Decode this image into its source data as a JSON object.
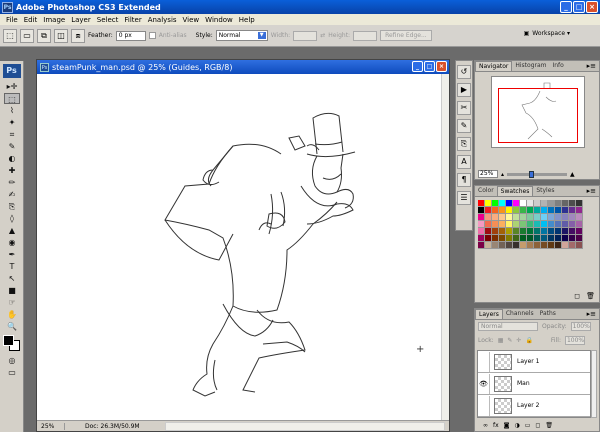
{
  "app": {
    "title": "Adobe Photoshop CS3 Extended",
    "icon_text": "Ps"
  },
  "window_controls": {
    "minimize": "_",
    "maximize": "□",
    "close": "×"
  },
  "menu": [
    "File",
    "Edit",
    "Image",
    "Layer",
    "Select",
    "Filter",
    "Analysis",
    "View",
    "Window",
    "Help"
  ],
  "options_bar": {
    "feather_label": "Feather:",
    "feather_value": "0 px",
    "antialias_label": "Anti-alias",
    "style_label": "Style:",
    "style_value": "Normal",
    "width_label": "Width:",
    "height_label": "Height:",
    "refine_edge": "Refine Edge...",
    "workspace": "Workspace ▾"
  },
  "tools": {
    "logo": "Ps",
    "icons": [
      "▸✛",
      "⬚",
      "⌇",
      "✦",
      "⌗",
      "✎",
      "◐",
      "✚",
      "✏",
      "✍",
      "⎘",
      "◊",
      "▲",
      "◉",
      "✒",
      "T",
      "↖",
      "■",
      "☞",
      "✋",
      "🔍"
    ]
  },
  "document": {
    "title": "steamPunk_man.psd @ 25% (Guides, RGB/8)",
    "icon_text": "Ps",
    "zoom": "25%",
    "doc_size": "Doc: 26.3M/50.9M"
  },
  "navigator": {
    "tabs": [
      "Navigator",
      "Histogram",
      "Info"
    ],
    "zoom": "25%"
  },
  "swatches_panel": {
    "tabs": [
      "Color",
      "Swatches",
      "Styles"
    ],
    "colors": [
      "#ff0000",
      "#ffff00",
      "#00ff00",
      "#00ffff",
      "#0000ff",
      "#ff00ff",
      "#ffffff",
      "#e6e6e6",
      "#cccccc",
      "#b3b3b3",
      "#999999",
      "#808080",
      "#666666",
      "#4d4d4d",
      "#333333",
      "#000000",
      "#ed1c24",
      "#f26522",
      "#f7941d",
      "#fff200",
      "#8dc63f",
      "#39b54a",
      "#00a651",
      "#00a99d",
      "#00aeef",
      "#0072bc",
      "#0054a6",
      "#2e3192",
      "#662d91",
      "#92278f",
      "#ec008c",
      "#f7977a",
      "#f9ad81",
      "#fdc68a",
      "#fff79a",
      "#c4df9b",
      "#a3d39c",
      "#82ca9d",
      "#7bcdc8",
      "#6ecff6",
      "#7ea7d8",
      "#8493ca",
      "#8882be",
      "#a187be",
      "#bc8dbf",
      "#f49ac2",
      "#f26c4f",
      "#f68e56",
      "#fbaf5d",
      "#fff568",
      "#acd373",
      "#7cc576",
      "#3bb878",
      "#1abbb4",
      "#00bff3",
      "#438ccb",
      "#5574b9",
      "#605ca8",
      "#855fa8",
      "#a763a8",
      "#f06eaa",
      "#9e0b0f",
      "#a0410d",
      "#a36209",
      "#aba000",
      "#598527",
      "#1a7b30",
      "#007236",
      "#00746b",
      "#0076a3",
      "#004b80",
      "#003471",
      "#1b1464",
      "#440e62",
      "#630460",
      "#9e005d",
      "#790000",
      "#7b2e00",
      "#7d4900",
      "#827b00",
      "#406618",
      "#005e20",
      "#005826",
      "#005952",
      "#005b7f",
      "#003663",
      "#002157",
      "#0d004c",
      "#32004b",
      "#4b0049",
      "#7b0046",
      "#c7b299",
      "#998675",
      "#736357",
      "#534741",
      "#37302d",
      "#c69c6d",
      "#a67c52",
      "#8c6239",
      "#754c24",
      "#603913",
      "#3c2415",
      "#d1a59a",
      "#a36b6b",
      "#8a5252"
    ]
  },
  "layers_panel": {
    "tabs": [
      "Layers",
      "Channels",
      "Paths"
    ],
    "blend_mode": "Normal",
    "opacity_label": "Opacity:",
    "opacity_value": "100%",
    "lock_label": "Lock:",
    "fill_label": "Fill:",
    "fill_value": "100%",
    "layers": [
      {
        "name": "Layer 1",
        "visible": false
      },
      {
        "name": "Man",
        "visible": true
      },
      {
        "name": "Layer 2",
        "visible": false
      }
    ]
  },
  "icons": {
    "pan": "hand-icon",
    "crosshair": "crosshair-cursor-icon"
  }
}
